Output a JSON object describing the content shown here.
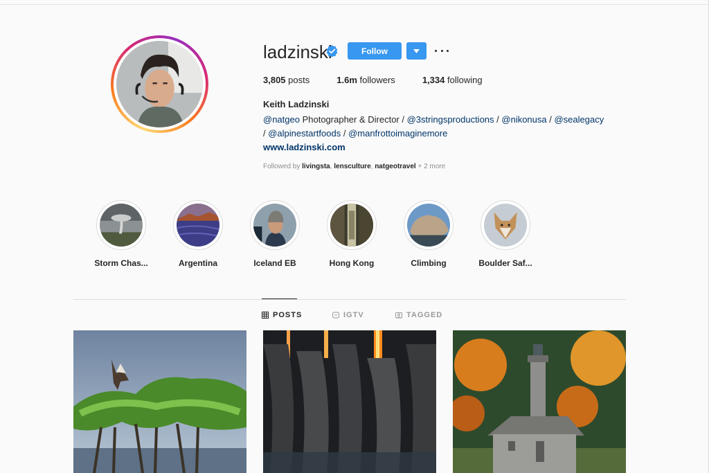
{
  "profile": {
    "username": "ladzinski",
    "follow_label": "Follow",
    "stats": {
      "posts_count": "3,805",
      "posts_label": "posts",
      "followers_count": "1.6m",
      "followers_label": "followers",
      "following_count": "1,334",
      "following_label": "following"
    },
    "full_name": "Keith Ladzinski",
    "bio": {
      "mention_natgeo": "@natgeo",
      "text_role": " Photographer & Director / ",
      "mention_3strings": "@3stringsproductions",
      "sep1": " / ",
      "mention_nikon": "@nikonusa",
      "sep2": " / ",
      "mention_sealegacy": "@sealegacy",
      "sep3": "/ ",
      "mention_alpine": "@alpinestartfoods",
      "sep4": " / ",
      "mention_manfrotto": "@manfrottoimaginemore"
    },
    "website": "www.ladzinski.com",
    "followed_by": {
      "prefix": "Followed by ",
      "user1": "livingsta",
      "comma1": ", ",
      "user2": "lensculture",
      "comma2": ", ",
      "user3": "natgeotravel",
      "suffix": " + 2 more"
    }
  },
  "highlights": [
    {
      "label": "Storm Chas..."
    },
    {
      "label": "Argentina"
    },
    {
      "label": "Iceland EB"
    },
    {
      "label": "Hong Kong"
    },
    {
      "label": "Climbing"
    },
    {
      "label": "Boulder Saf..."
    }
  ],
  "tabs": [
    {
      "label": "POSTS",
      "icon": "grid-icon",
      "active": true
    },
    {
      "label": "IGTV",
      "icon": "tv-icon",
      "active": false
    },
    {
      "label": "TAGGED",
      "icon": "tag-icon",
      "active": false
    }
  ],
  "colors": {
    "accent": "#3897f0",
    "link": "#003569",
    "text": "#262626",
    "muted": "#8e8e8e",
    "verified": "#3897f0"
  }
}
